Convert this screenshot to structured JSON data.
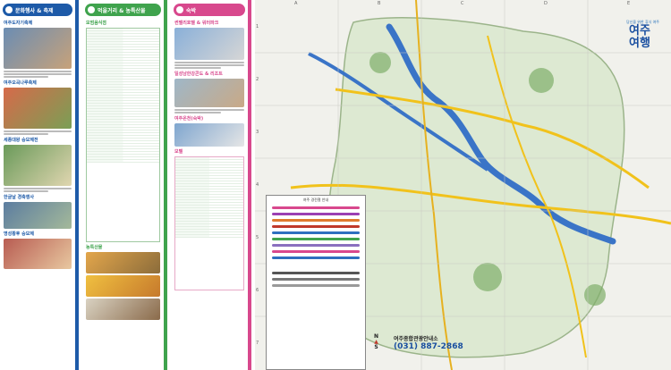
{
  "panels": {
    "culture": {
      "header": "문화행사 & 축제",
      "color": "#1d5aa8",
      "sections": [
        "여주도자기축제",
        "여주오곡나루축제",
        "세종대왕 숭모제전",
        "한글날 경축행사",
        "명성황후 숭모제"
      ]
    },
    "food": {
      "header": "먹을거리 & 농특산물",
      "color": "#3fa34d",
      "sections": [
        "모범음식점",
        "농특산물"
      ]
    },
    "stay": {
      "header": "숙박",
      "color": "#d8488d",
      "sections": [
        "썬밸리호텔 & 워터파크",
        "일성남한강콘도 & 리조트",
        "여주온천(숙박)",
        "모텔"
      ]
    }
  },
  "map": {
    "columns": [
      "A",
      "B",
      "C",
      "D",
      "E"
    ],
    "rows": [
      "1",
      "2",
      "3",
      "4",
      "5",
      "6",
      "7"
    ],
    "legend_title": "여주 경전철 안내",
    "logo_small": "당신을 위한 휴식 여주",
    "logo_main": "여주여행",
    "info_label": "여주종합관광안내소",
    "info_phone": "(031) 887-2868",
    "compass": [
      "N",
      "S"
    ]
  }
}
